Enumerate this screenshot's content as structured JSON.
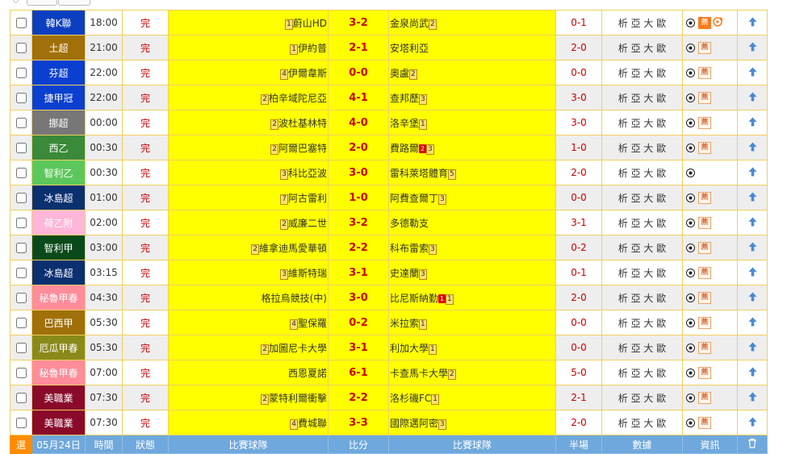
{
  "matches": [
    {
      "league": "韓K聯",
      "league_color": "#0b3fbf",
      "time": "18:00",
      "status": "完",
      "home_rank": "1",
      "home": "蔚山HD",
      "score": "3-2",
      "away": "金泉尚武",
      "away_rank": "2",
      "half": "0-1",
      "analysis": "析 亞 大 歐",
      "rec_label": "薦",
      "rec_solid": true,
      "sound": true,
      "home_cards": [],
      "away_cards": []
    },
    {
      "league": "土超",
      "league_color": "#a0700a",
      "time": "21:00",
      "status": "完",
      "home_rank": "1",
      "home": "伊約普",
      "score": "2-1",
      "away": "安塔利亞",
      "away_rank": "",
      "half": "2-0",
      "analysis": "析 亞 大 歐",
      "rec_label": "薦",
      "rec_solid": false,
      "sound": false,
      "home_cards": [],
      "away_cards": []
    },
    {
      "league": "芬超",
      "league_color": "#0a3fd0",
      "time": "22:00",
      "status": "完",
      "home_rank": "4",
      "home": "伊爾韋斯",
      "score": "0-0",
      "away": "奧盧",
      "away_rank": "2",
      "half": "0-0",
      "analysis": "析 亞 大 歐",
      "rec_label": "薦",
      "rec_solid": false,
      "sound": false,
      "home_cards": [],
      "away_cards": []
    },
    {
      "league": "捷甲冠",
      "league_color": "#0a3fd0",
      "time": "22:00",
      "status": "完",
      "home_rank": "2",
      "home": "柏辛域陀尼亞",
      "score": "4-1",
      "away": "查邦歷",
      "away_rank": "3",
      "half": "3-0",
      "analysis": "析 亞 大 歐",
      "rec_label": "薦",
      "rec_solid": false,
      "sound": false,
      "home_cards": [],
      "away_cards": []
    },
    {
      "league": "挪超",
      "league_color": "#777777",
      "time": "00:00",
      "status": "完",
      "home_rank": "2",
      "home": "波杜基林特",
      "score": "4-0",
      "away": "洛辛堡",
      "away_rank": "1",
      "half": "3-0",
      "analysis": "析 亞 大 歐",
      "rec_label": "薦",
      "rec_solid": false,
      "sound": false,
      "home_cards": [],
      "away_cards": []
    },
    {
      "league": "西乙",
      "league_color": "#3a8a3a",
      "time": "00:30",
      "status": "完",
      "home_rank": "2",
      "home": "阿爾巴塞特",
      "score": "2-0",
      "away": "費路爾",
      "away_rank": "3",
      "half": "1-0",
      "analysis": "析 亞 大 歐",
      "rec_label": "薦",
      "rec_solid": false,
      "sound": false,
      "home_cards": [],
      "away_cards": [
        "2"
      ]
    },
    {
      "league": "智利乙",
      "league_color": "#5cc85c",
      "time": "00:30",
      "status": "完",
      "home_rank": "3",
      "home": "科比亞波",
      "score": "3-0",
      "away": "雷科萊塔體育",
      "away_rank": "5",
      "half": "2-0",
      "analysis": "析 亞 大 歐",
      "rec_label": "",
      "rec_solid": false,
      "sound": false,
      "home_cards": [],
      "away_cards": []
    },
    {
      "league": "冰島超",
      "league_color": "#0a3070",
      "time": "01:00",
      "status": "完",
      "home_rank": "7",
      "home": "阿古雷利",
      "score": "1-0",
      "away": "阿費查爾丁",
      "away_rank": "3",
      "half": "0-0",
      "analysis": "析 亞 大 歐",
      "rec_label": "薦",
      "rec_solid": false,
      "sound": false,
      "home_cards": [],
      "away_cards": []
    },
    {
      "league": "荷乙附",
      "league_color": "#ffb6d8",
      "time": "02:00",
      "status": "完",
      "home_rank": "2",
      "home": "威廉二世",
      "score": "3-2",
      "away": "多德勒支",
      "away_rank": "",
      "half": "3-1",
      "analysis": "析 亞 大 歐",
      "rec_label": "薦",
      "rec_solid": false,
      "sound": false,
      "home_cards": [],
      "away_cards": []
    },
    {
      "league": "智利甲",
      "league_color": "#0a4a1a",
      "time": "03:00",
      "status": "完",
      "home_rank": "2",
      "home": "維拿迪馬愛華頓",
      "score": "2-2",
      "away": "科布雷索",
      "away_rank": "3",
      "half": "0-2",
      "analysis": "析 亞 大 歐",
      "rec_label": "薦",
      "rec_solid": false,
      "sound": false,
      "home_cards": [],
      "away_cards": []
    },
    {
      "league": "冰島超",
      "league_color": "#0a3070",
      "time": "03:15",
      "status": "完",
      "home_rank": "3",
      "home": "維斯特瑞",
      "score": "3-1",
      "away": "史達蘭",
      "away_rank": "3",
      "half": "0-1",
      "analysis": "析 亞 大 歐",
      "rec_label": "薦",
      "rec_solid": false,
      "sound": false,
      "home_cards": [],
      "away_cards": []
    },
    {
      "league": "秘魯甲春",
      "league_color": "#ff8c9a",
      "time": "04:30",
      "status": "完",
      "home_rank": "",
      "home": "格拉烏競技(中)",
      "score": "3-0",
      "away": "比尼斯納勤",
      "away_rank": "1",
      "half": "2-0",
      "analysis": "析 亞 大 歐",
      "rec_label": "薦",
      "rec_solid": false,
      "sound": false,
      "home_cards": [],
      "away_cards": [
        "1"
      ]
    },
    {
      "league": "巴西甲",
      "league_color": "#a0700a",
      "time": "05:30",
      "status": "完",
      "home_rank": "4",
      "home": "聖保羅",
      "score": "0-2",
      "away": "米拉索",
      "away_rank": "1",
      "half": "0-0",
      "analysis": "析 亞 大 歐",
      "rec_label": "薦",
      "rec_solid": false,
      "sound": false,
      "home_cards": [],
      "away_cards": []
    },
    {
      "league": "厄瓜甲春",
      "league_color": "#8a8a1a",
      "time": "05:30",
      "status": "完",
      "home_rank": "2",
      "home": "加圖尼卡大學",
      "score": "3-1",
      "away": "利加大學",
      "away_rank": "1",
      "half": "0-0",
      "analysis": "析 亞 大 歐",
      "rec_label": "薦",
      "rec_solid": false,
      "sound": false,
      "home_cards": [],
      "away_cards": []
    },
    {
      "league": "秘魯甲春",
      "league_color": "#ff8c9a",
      "time": "07:00",
      "status": "完",
      "home_rank": "",
      "home": "西恩夏諾",
      "score": "6-1",
      "away": "卡查馬卡大學",
      "away_rank": "2",
      "half": "5-0",
      "analysis": "析 亞 大 歐",
      "rec_label": "薦",
      "rec_solid": false,
      "sound": false,
      "home_cards": [],
      "away_cards": []
    },
    {
      "league": "美職業",
      "league_color": "#8a0a2a",
      "time": "07:30",
      "status": "完",
      "home_rank": "2",
      "home": "蒙特利爾衝擊",
      "score": "2-2",
      "away": "洛杉磯FC",
      "away_rank": "1",
      "half": "2-1",
      "analysis": "析 亞 大 歐",
      "rec_label": "薦",
      "rec_solid": false,
      "sound": false,
      "home_cards": [],
      "away_cards": []
    },
    {
      "league": "美職業",
      "league_color": "#8a0a2a",
      "time": "07:30",
      "status": "完",
      "home_rank": "4",
      "home": "費城聯",
      "score": "3-3",
      "away": "國際邁阿密",
      "away_rank": "3",
      "half": "2-0",
      "analysis": "析 亞 大 歐",
      "rec_label": "薦",
      "rec_solid": false,
      "sound": false,
      "home_cards": [],
      "away_cards": []
    }
  ],
  "footer": {
    "select": "選",
    "date": "05月24日",
    "time": "時間",
    "status": "狀態",
    "home": "比賽球隊",
    "score": "比分",
    "away": "比賽球隊",
    "half": "半場",
    "data": "數據",
    "info": "資訊"
  }
}
